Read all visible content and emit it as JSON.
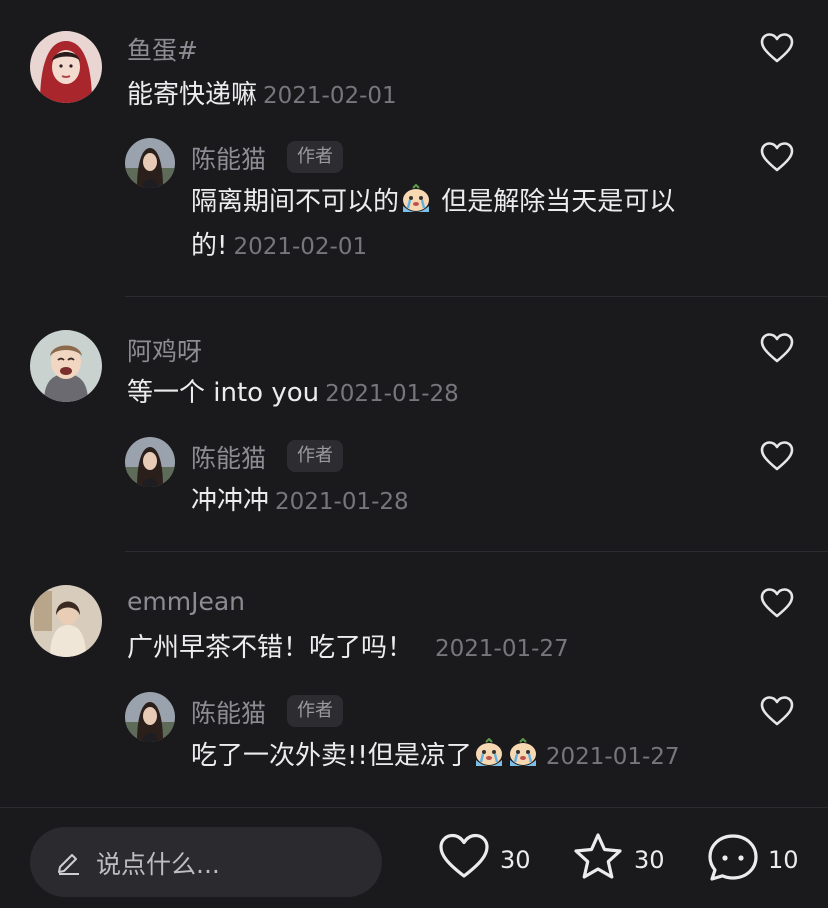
{
  "comments": [
    {
      "user": "鱼蛋#",
      "text": "能寄快递嘛",
      "date": "2021-02-01",
      "reply": {
        "user": "陈能猫",
        "badge": "作者",
        "text_part1": "隔离期间不可以的",
        "text_part2": " 但是解除当天是可以",
        "text_part3": "的!",
        "date": "2021-02-01"
      }
    },
    {
      "user": "阿鸡呀",
      "text": "等一个 into you",
      "date": "2021-01-28",
      "reply": {
        "user": "陈能猫",
        "badge": "作者",
        "text": "冲冲冲",
        "date": "2021-01-28"
      }
    },
    {
      "user": "emmJean",
      "text": "广州早茶不错！吃了吗！",
      "date": "2021-01-27",
      "reply": {
        "user": "陈能猫",
        "badge": "作者",
        "text": "吃了一次外卖!!但是凉了",
        "date": "2021-01-27"
      }
    }
  ],
  "bottom_bar": {
    "placeholder": "说点什么...",
    "likes": "30",
    "favorites": "30",
    "comments": "10"
  },
  "icons": {
    "like": "heart-outline-icon",
    "favorite": "star-outline-icon",
    "comment": "speech-bubble-icon",
    "compose": "pencil-icon",
    "crying": "crying-emoji-icon"
  },
  "colors": {
    "background": "#1a1a1d",
    "text": "#ececee",
    "muted": "#8c8c92",
    "badge_bg": "#2c2c31"
  }
}
